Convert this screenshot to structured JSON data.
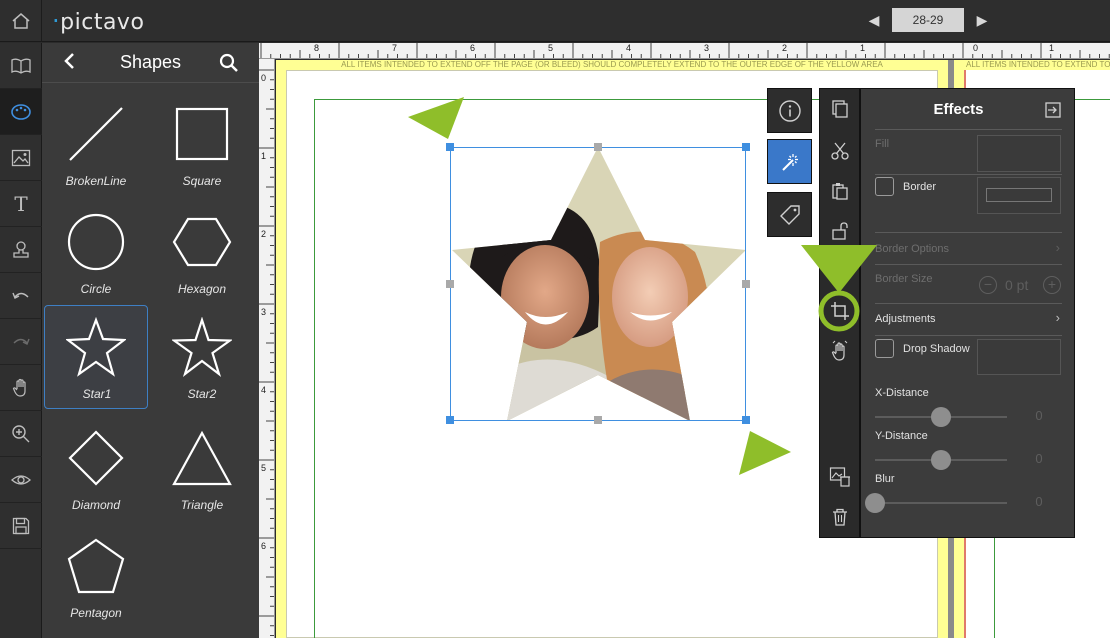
{
  "app": {
    "logo": "pictavo"
  },
  "pager": {
    "page_number": "28-29"
  },
  "rail": {
    "items": [
      "home-icon",
      "book-icon",
      "palette-icon",
      "image-icon",
      "text-icon",
      "stamp-icon",
      "undo-icon",
      "redo-icon",
      "hand-icon",
      "zoom-icon",
      "preview-icon",
      "save-icon"
    ]
  },
  "shapes_panel": {
    "title": "Shapes",
    "shapes": [
      {
        "label": "BrokenLine"
      },
      {
        "label": "Square"
      },
      {
        "label": "Circle"
      },
      {
        "label": "Hexagon"
      },
      {
        "label": "Star1"
      },
      {
        "label": "Star2"
      },
      {
        "label": "Diamond"
      },
      {
        "label": "Triangle"
      },
      {
        "label": "Pentagon"
      }
    ]
  },
  "rulers": {
    "top": [
      "8",
      "7",
      "6",
      "5",
      "4",
      "3",
      "2",
      "1",
      "0",
      "1"
    ],
    "left": [
      "0",
      "1",
      "2",
      "3",
      "4",
      "5",
      "6"
    ]
  },
  "canvas": {
    "bleed_note": "ALL ITEMS INTENDED TO EXTEND OFF THE PAGE (OR BLEED) SHOULD COMPLETELY EXTEND TO THE OUTER EDGE OF THE YELLOW AREA",
    "bleed_note_right": "ALL ITEMS INTENDED TO EXTEND TO"
  },
  "effects": {
    "title": "Effects",
    "fill_label": "Fill",
    "border_label": "Border",
    "border_options_label": "Border Options",
    "border_size_label": "Border Size",
    "border_size_value": "0 pt",
    "adjustments_label": "Adjustments",
    "drop_shadow_label": "Drop Shadow",
    "x_distance_label": "X-Distance",
    "x_distance_value": "0",
    "y_distance_label": "Y-Distance",
    "y_distance_value": "0",
    "blur_label": "Blur",
    "blur_value": "0"
  },
  "colors": {
    "accent": "#3a78c9",
    "annotation": "#8fbe2a",
    "bleed": "#ffff94",
    "margin": "#3c9a3c"
  }
}
